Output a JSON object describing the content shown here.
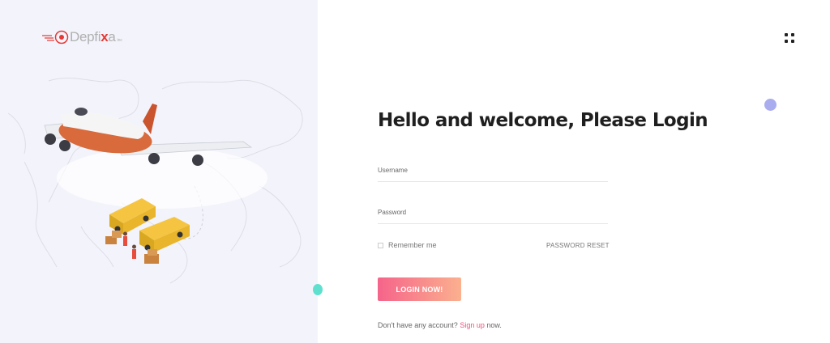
{
  "brand": {
    "logo_main": "Depfi",
    "logo_accent": "x",
    "logo_end": "a",
    "logo_sub": "inc"
  },
  "header": {
    "menu_icon": "grid-menu-icon"
  },
  "login": {
    "title": "Hello and welcome, Please Login",
    "username_placeholder": "Username",
    "password_placeholder": "Password",
    "remember_label": "Remember me",
    "reset_label": "PASSWORD RESET",
    "submit_label": "LOGIN NOW!",
    "signup_prefix": "Don't have any account?",
    "signup_link": "Sign up",
    "signup_suffix": "now."
  },
  "colors": {
    "accent_pink": "#f5648a",
    "accent_peach": "#fbb08e",
    "link": "#f0517c",
    "dot_purple": "#a9adf0",
    "dot_teal": "#5fe0cf"
  }
}
